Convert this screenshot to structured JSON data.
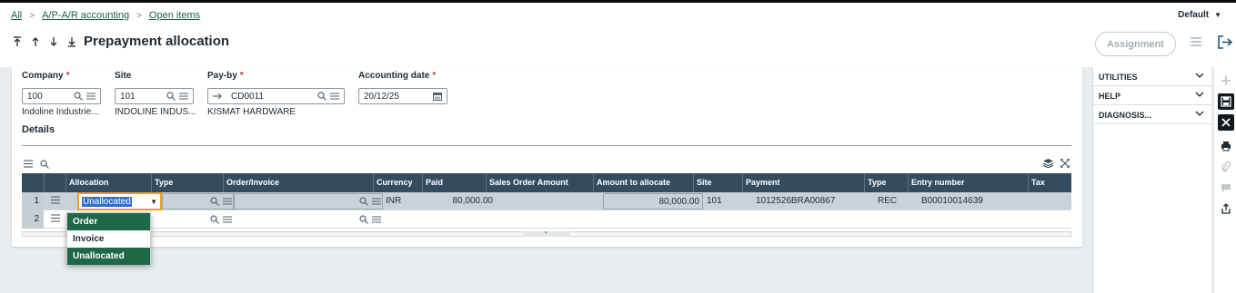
{
  "breadcrumb": {
    "items": [
      "All",
      "A/P-A/R accounting",
      "Open items"
    ]
  },
  "header": {
    "title": "Prepayment allocation",
    "default_selector": "Default",
    "assignment_button": "Assignment"
  },
  "form": {
    "company": {
      "label": "Company",
      "required_mark": "*",
      "value": "100",
      "description": "Indoline Industrie..."
    },
    "site": {
      "label": "Site",
      "value": "101",
      "description": "INDOLINE INDUS..."
    },
    "payby": {
      "label": "Pay-by",
      "required_mark": "*",
      "value": "CD0011",
      "description": "KISMAT HARDWARE"
    },
    "accounting_date": {
      "label": "Accounting date",
      "required_mark": "*",
      "value": "20/12/25"
    }
  },
  "details": {
    "title": "Details",
    "columns": [
      "Allocation",
      "Type",
      "Order/Invoice",
      "Currency",
      "Paid",
      "Sales Order Amount",
      "Amount to allocate",
      "Site",
      "Payment",
      "Type",
      "Entry number",
      "Tax"
    ],
    "rows": [
      {
        "num": "1",
        "allocation": "Unallocated",
        "type": "",
        "order_invoice": "",
        "currency": "INR",
        "paid": "80,000.00",
        "sales_order_amount": "",
        "amount_to_allocate": "80,000.00",
        "site": "101",
        "payment": "1012526BRA00867",
        "type2": "REC",
        "entry_number": "B00010014639",
        "tax": ""
      },
      {
        "num": "2"
      }
    ]
  },
  "dropdown": {
    "options": [
      {
        "label": "Order",
        "highlighted": true
      },
      {
        "label": "Invoice",
        "highlighted": false
      },
      {
        "label": "Unallocated",
        "highlighted": true
      }
    ]
  },
  "right_panel": {
    "sections": [
      "UTILITIES",
      "HELP",
      "DIAGNOSIS..."
    ]
  },
  "colors": {
    "accent_green": "#1e6848",
    "grid_header": "#354c5f",
    "focus_border": "#e8a32a",
    "required": "#c0392b"
  }
}
